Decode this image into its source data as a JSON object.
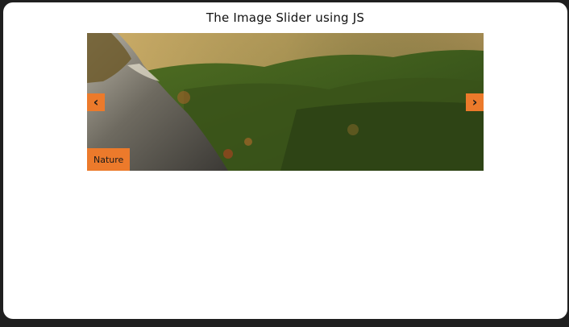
{
  "page": {
    "title": "The Image Slider using JS"
  },
  "slider": {
    "prev_icon": "chevron-left",
    "prev_glyph": "‹",
    "next_icon": "chevron-right",
    "next_glyph": "›",
    "caption": "Nature",
    "accent_color": "#ec7a2b",
    "image": "mountain forest landscape with rocky cliff"
  }
}
